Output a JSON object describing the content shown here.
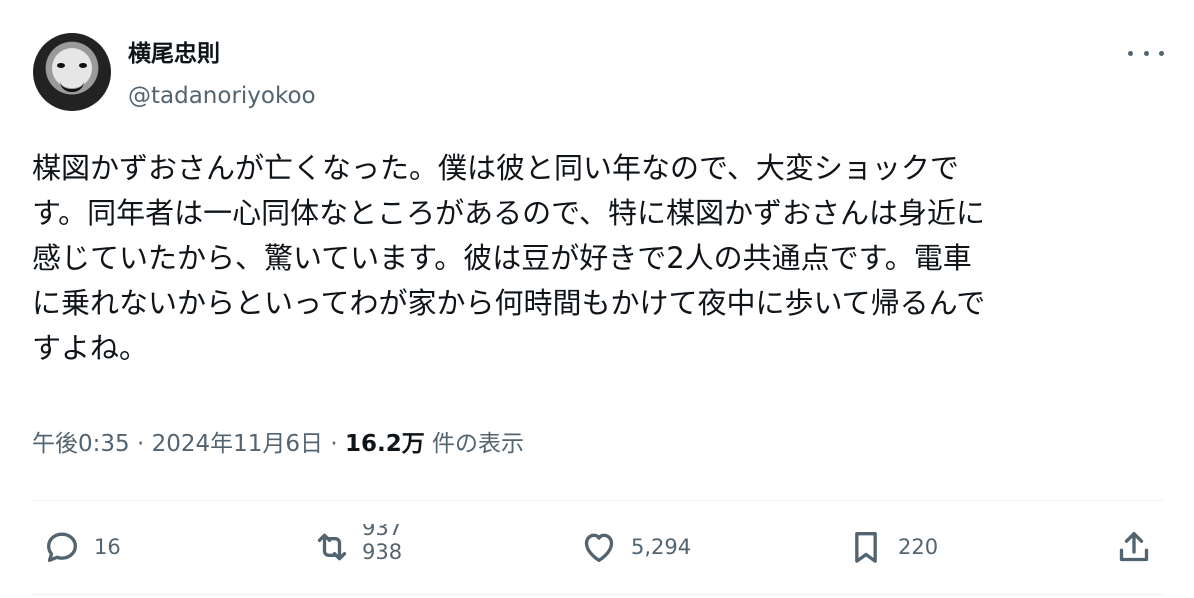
{
  "post": {
    "author_name": "横尾忠則",
    "author_handle": "@tadanoriyokoo",
    "text": "楳図かずおさんが亡くなった。僕は彼と同い年なので、大変ショックで\nす。同年者は一心同体なところがあるので、特に楳図かずおさんは身近に\n感じていたから、驚いています。彼は豆が好きで2人の共通点です。電車\nに乗れないからといってわが家から何時間もかけて夜中に歩いて帰るんで\nすよね。",
    "time": "午後0:35",
    "date": "2024年11月6日",
    "separator": " · ",
    "views_count": "16.2万",
    "views_label": "件の表示"
  },
  "actions": {
    "reply_count": "16",
    "retweet_count_old": "937",
    "retweet_count_new": "938",
    "like_count": "5,294",
    "bookmark_count": "220"
  },
  "icons": {
    "reply": "speech-bubble-icon",
    "retweet": "retweet-arrows-icon",
    "like": "heart-icon",
    "bookmark": "bookmark-icon",
    "share": "share-upload-icon",
    "more": "more-dots-icon"
  }
}
